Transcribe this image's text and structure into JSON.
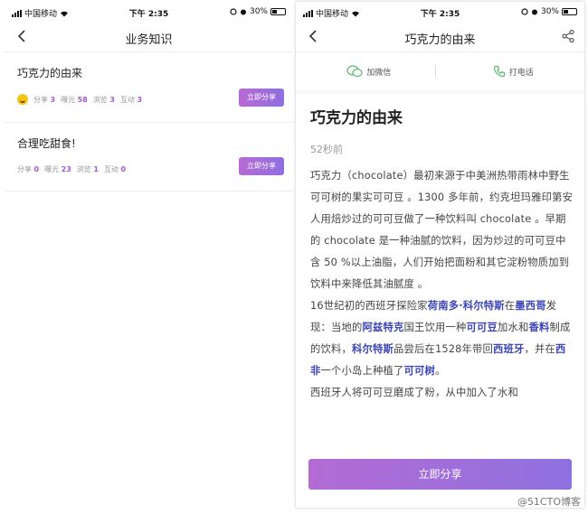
{
  "status": {
    "carrier": "中国移动",
    "time": "下午 2:35",
    "battery": "30%"
  },
  "left": {
    "nav_title": "业务知识",
    "items": [
      {
        "title": "巧克力的由来",
        "share_label": "分享",
        "share": "3",
        "exposure_label": "曝光",
        "exposure": "58",
        "view_label": "浏览",
        "view": "3",
        "interact_label": "互动",
        "interact": "3",
        "button": "立即分享"
      },
      {
        "title": "合理吃甜食!",
        "share_label": "分享",
        "share": "0",
        "exposure_label": "曝光",
        "exposure": "23",
        "view_label": "浏览",
        "view": "1",
        "interact_label": "互动",
        "interact": "0",
        "button": "立即分享"
      }
    ]
  },
  "right": {
    "nav_title": "巧克力的由来",
    "wechat_label": "加微信",
    "phone_label": "打电话",
    "article_title": "巧克力的由来",
    "time_ago": "52秒前",
    "p1": "巧克力（chocolate）最初来源于中美洲热带雨林中野生可可树的果实可可豆 。1300 多年前，约克坦玛雅印第安人用焙炒过的可可豆做了一种饮料叫 chocolate 。早期的 chocolate 是一种油腻的饮料，因为炒过的可可豆中含 50 %以上油脂，人们开始把面粉和其它淀粉物质加到饮料中来降低其油腻度 。",
    "p2": {
      "a": "16世纪初的西班牙探险家",
      "b": "荷南多·科尔特斯",
      "c": "在",
      "d": "墨西哥",
      "e": "发现：当地的",
      "f": "阿兹特克",
      "g": "国王饮用一种",
      "h": "可可豆",
      "i": "加水和",
      "j": "香料",
      "k": "制成的饮料，",
      "l": "科尔特斯",
      "m": "品尝后在1528年带回",
      "n": "西班牙",
      "o": "，并在",
      "p": "西非",
      "q": "一个小岛上种植了",
      "r": "可可树",
      "s": "。"
    },
    "p3": "西班牙人将可可豆磨成了粉，从中加入了水和",
    "button": "立即分享"
  },
  "watermark": "@51CTO博客"
}
